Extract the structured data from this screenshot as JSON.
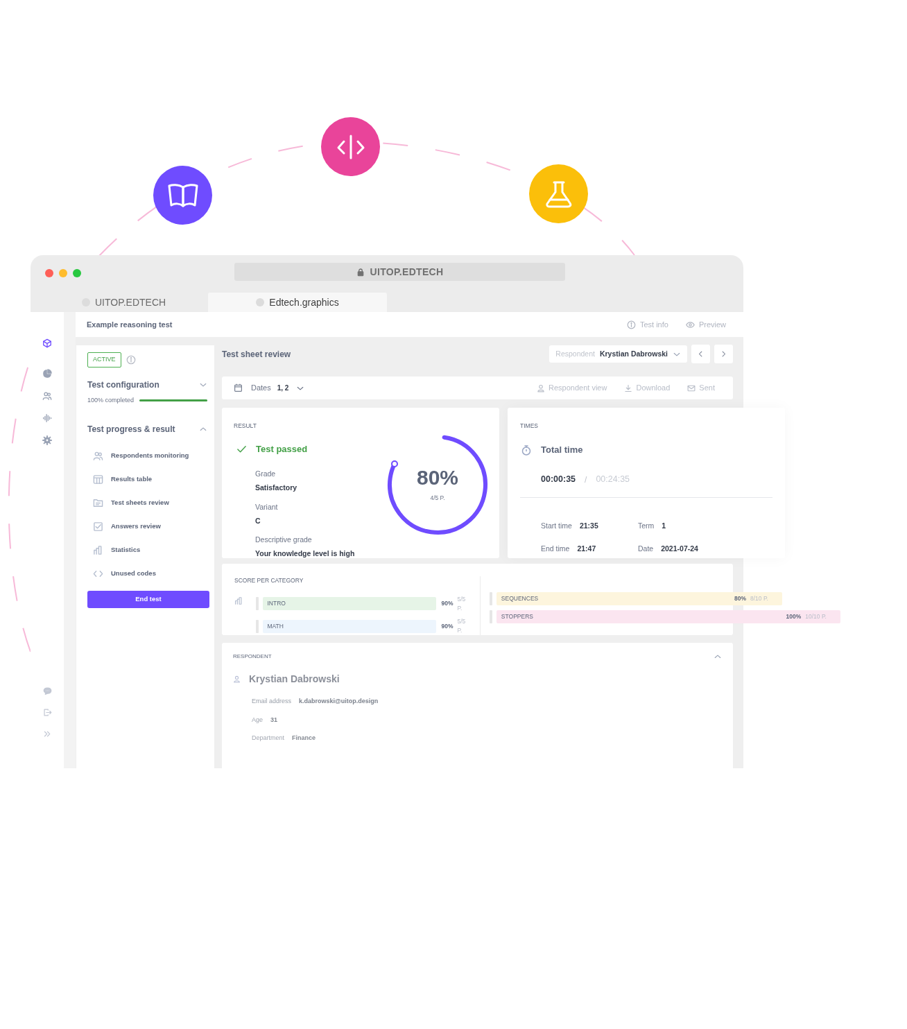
{
  "window": {
    "address": "UITOP.EDTECH",
    "tabs": [
      {
        "label": "UITOP.EDTECH",
        "selected": false
      },
      {
        "label": "Edtech.graphics",
        "selected": true
      }
    ]
  },
  "header": {
    "title": "Example reasoning test",
    "actions": [
      {
        "kind": "info",
        "label": "Test info"
      },
      {
        "kind": "eye",
        "label": "Preview"
      }
    ]
  },
  "rail": [
    {
      "kind": "cube",
      "selected": true
    },
    {
      "kind": "pie",
      "selected": false
    },
    {
      "kind": "users",
      "selected": false
    },
    {
      "kind": "wave",
      "selected": false
    },
    {
      "kind": "gear",
      "selected": false
    }
  ],
  "rail_bottom": [
    {
      "kind": "chat"
    },
    {
      "kind": "logout"
    },
    {
      "kind": "expand"
    }
  ],
  "left_panel": {
    "status": "ACTIVE",
    "config": {
      "title": "Test configuration",
      "expanded": false,
      "progress_label": "100% completed",
      "level": 1
    },
    "progress": {
      "title": "Test progress & result",
      "expanded": true,
      "items": [
        {
          "kind": "users",
          "label": "Respondents monitoring"
        },
        {
          "kind": "table",
          "label": "Results table"
        },
        {
          "kind": "folder",
          "label": "Test sheets review"
        },
        {
          "kind": "check",
          "label": "Answers review"
        },
        {
          "kind": "bars",
          "label": "Statistics"
        },
        {
          "kind": "code",
          "label": "Unused codes"
        }
      ]
    },
    "end_button": "End test"
  },
  "main": {
    "title": "Test sheet review",
    "respondent_label": "Respondent",
    "respondent": "Krystian Dabrowski",
    "toolbar": {
      "dates_label": "Dates",
      "dates_value": "1, 2",
      "actions": [
        {
          "kind": "user",
          "label": "Respondent view"
        },
        {
          "kind": "download",
          "label": "Download"
        },
        {
          "kind": "mail",
          "label": "Sent"
        }
      ]
    }
  },
  "result": {
    "heading": "RESULT",
    "status": "Test passed",
    "fields": [
      {
        "label": "Grade",
        "value": "Satisfactory"
      },
      {
        "label": "Variant",
        "value": "C"
      },
      {
        "label": "Descriptive grade",
        "value": "Your knowledge level is high"
      }
    ],
    "percent": "80%",
    "points": "4/5 P.",
    "level": 0.8
  },
  "times": {
    "heading": "TIMES",
    "title": "Total time",
    "elapsed": "00:00:35",
    "separator": "/",
    "limit": "00:24:35",
    "fields": [
      {
        "label": "Start time",
        "value": "21:35"
      },
      {
        "label": "Term",
        "value": "1"
      },
      {
        "label": "End time",
        "value": "21:47"
      },
      {
        "label": "Date",
        "value": "2021-07-24"
      }
    ]
  },
  "scores": {
    "heading": "SCORE PER CATEGORY",
    "columns": [
      {
        "categories": [
          {
            "name": "INTRO",
            "percent": "90%",
            "points": "5/5 P.",
            "color": "#e6f4e7"
          },
          {
            "name": "MATH",
            "percent": "90%",
            "points": "5/5 P.",
            "color": "#edf5fd"
          }
        ]
      },
      {
        "categories": [
          {
            "name": "SEQUENCES",
            "percent": "80%",
            "points": "8/10 P.",
            "color": "#fdf5dd"
          },
          {
            "name": "STOPPERS",
            "percent": "100%",
            "points": "10/10 P.",
            "color": "#fbe5f0"
          }
        ]
      }
    ]
  },
  "respondent": {
    "heading": "RESPONDENT",
    "expanded": true,
    "name": "Krystian Dabrowski",
    "fields": [
      {
        "label": "Email address",
        "value": "k.dabrowski@uitop.design"
      },
      {
        "label": "Age",
        "value": "31"
      },
      {
        "label": "Department",
        "value": "Finance"
      }
    ]
  }
}
